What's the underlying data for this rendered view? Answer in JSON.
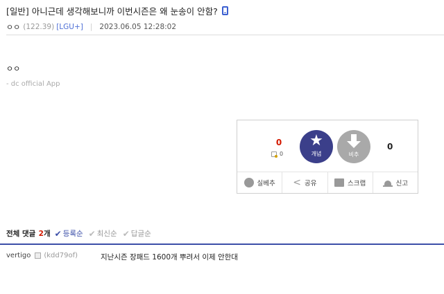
{
  "post": {
    "title": "[일반] 아니근데 생각해보니까 이번시즌은 왜 눈송이 안함?",
    "author_nick": "ㅇㅇ",
    "author_ip": "(122.39)",
    "carrier": "[LGU+]",
    "date": "2023.06.05 12:28:02",
    "body": "ㅇㅇ",
    "signature": "- dc official App"
  },
  "recommend": {
    "up_count": "0",
    "fix_count": "0",
    "up_label": "개념",
    "down_label": "비추",
    "down_count": "0",
    "up_color": "#3b3f8a",
    "down_color": "#a9a9a9"
  },
  "actions": [
    {
      "label": "실베추",
      "icon": "b-circle-icon"
    },
    {
      "label": "공유",
      "icon": "share-icon"
    },
    {
      "label": "스크랩",
      "icon": "scrap-icon"
    },
    {
      "label": "신고",
      "icon": "siren-icon"
    }
  ],
  "comments": {
    "header_title": "전체 댓글",
    "count": "2",
    "unit": "개",
    "sort_options": [
      {
        "label": "등록순",
        "active": true
      },
      {
        "label": "최신순",
        "active": false
      },
      {
        "label": "답글순",
        "active": false
      }
    ],
    "items": [
      {
        "nick": "vertigo",
        "id": "(kdd79of)",
        "text": "지난시즌 장패드 1600개 뿌려서 이제 안한대"
      }
    ]
  },
  "colors": {
    "accent": "#3b4ea8",
    "count_red": "#d31900",
    "carrier_blue": "#4e6fd6"
  }
}
